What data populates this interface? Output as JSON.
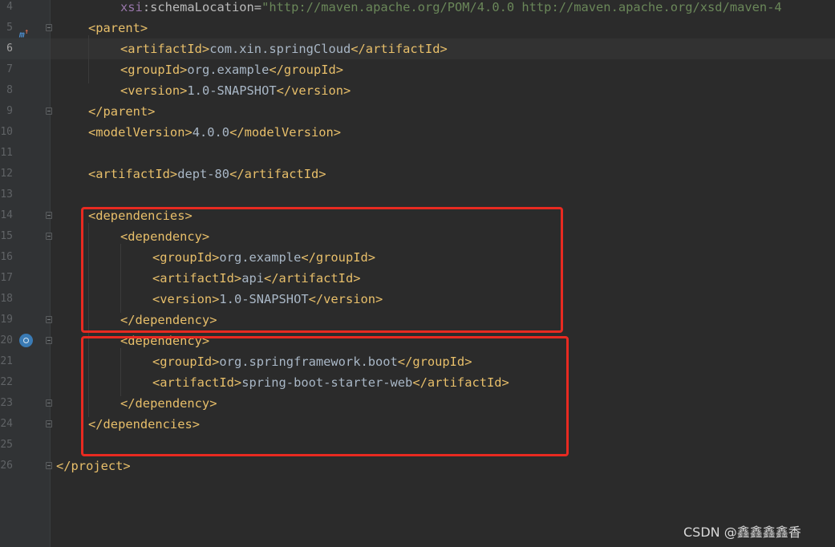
{
  "editor": {
    "current_line": "6",
    "lines": [
      {
        "num": "4",
        "tokens": [
          {
            "k": "ns",
            "t": "xsi"
          },
          {
            "k": "attr",
            "t": ":schemaLocation="
          },
          {
            "k": "str",
            "t": "\"http://maven.apache.org/POM/4.0.0 http://maven.apache.org/xsd/maven-4"
          }
        ]
      },
      {
        "num": "5",
        "tokens": [
          {
            "k": "tag",
            "t": "<parent>"
          }
        ]
      },
      {
        "num": "6",
        "tokens": [
          {
            "k": "tag",
            "t": "<artifactId>"
          },
          {
            "k": "txt",
            "t": "com.xin.springCloud"
          },
          {
            "k": "tag",
            "t": "</artifactId>"
          }
        ]
      },
      {
        "num": "7",
        "tokens": [
          {
            "k": "tag",
            "t": "<groupId>"
          },
          {
            "k": "txt",
            "t": "org.example"
          },
          {
            "k": "tag",
            "t": "</groupId>"
          }
        ]
      },
      {
        "num": "8",
        "tokens": [
          {
            "k": "tag",
            "t": "<version>"
          },
          {
            "k": "txt",
            "t": "1.0-SNAPSHOT"
          },
          {
            "k": "tag",
            "t": "</version>"
          }
        ]
      },
      {
        "num": "9",
        "tokens": [
          {
            "k": "tag",
            "t": "</parent>"
          }
        ]
      },
      {
        "num": "10",
        "tokens": [
          {
            "k": "tag",
            "t": "<modelVersion>"
          },
          {
            "k": "txt",
            "t": "4.0.0"
          },
          {
            "k": "tag",
            "t": "</modelVersion>"
          }
        ]
      },
      {
        "num": "11",
        "tokens": []
      },
      {
        "num": "12",
        "tokens": [
          {
            "k": "tag",
            "t": "<artifactId>"
          },
          {
            "k": "txt",
            "t": "dept-80"
          },
          {
            "k": "tag",
            "t": "</artifactId>"
          }
        ]
      },
      {
        "num": "13",
        "tokens": []
      },
      {
        "num": "14",
        "tokens": [
          {
            "k": "tag",
            "t": "<dependencies>"
          }
        ]
      },
      {
        "num": "15",
        "tokens": [
          {
            "k": "tag",
            "t": "<dependency>"
          }
        ]
      },
      {
        "num": "16",
        "tokens": [
          {
            "k": "tag",
            "t": "<groupId>"
          },
          {
            "k": "txt",
            "t": "org.example"
          },
          {
            "k": "tag",
            "t": "</groupId>"
          }
        ]
      },
      {
        "num": "17",
        "tokens": [
          {
            "k": "tag",
            "t": "<artifactId>"
          },
          {
            "k": "txt",
            "t": "api"
          },
          {
            "k": "tag",
            "t": "</artifactId>"
          }
        ]
      },
      {
        "num": "18",
        "tokens": [
          {
            "k": "tag",
            "t": "<version>"
          },
          {
            "k": "txt",
            "t": "1.0-SNAPSHOT"
          },
          {
            "k": "tag",
            "t": "</version>"
          }
        ]
      },
      {
        "num": "19",
        "tokens": [
          {
            "k": "tag",
            "t": "</dependency>"
          }
        ]
      },
      {
        "num": "20",
        "tokens": [
          {
            "k": "tag",
            "t": "<dependency>"
          }
        ]
      },
      {
        "num": "21",
        "tokens": [
          {
            "k": "tag",
            "t": "<groupId>"
          },
          {
            "k": "txt",
            "t": "org.springframework.boot"
          },
          {
            "k": "tag",
            "t": "</groupId>"
          }
        ]
      },
      {
        "num": "22",
        "tokens": [
          {
            "k": "tag",
            "t": "<artifactId>"
          },
          {
            "k": "txt",
            "t": "spring-boot-starter-web"
          },
          {
            "k": "tag",
            "t": "</artifactId>"
          }
        ]
      },
      {
        "num": "23",
        "tokens": [
          {
            "k": "tag",
            "t": "</dependency>"
          }
        ]
      },
      {
        "num": "24",
        "tokens": [
          {
            "k": "tag",
            "t": "</dependencies>"
          }
        ]
      },
      {
        "num": "25",
        "tokens": []
      },
      {
        "num": "26",
        "tokens": [
          {
            "k": "tag",
            "t": "</project>"
          }
        ]
      }
    ]
  },
  "highlight_color": "#e82a21",
  "gutter_icons": {
    "line5": "maven-parent-icon",
    "line20": "dependency-run-icon"
  },
  "watermark": "CSDN @鑫鑫鑫鑫香"
}
